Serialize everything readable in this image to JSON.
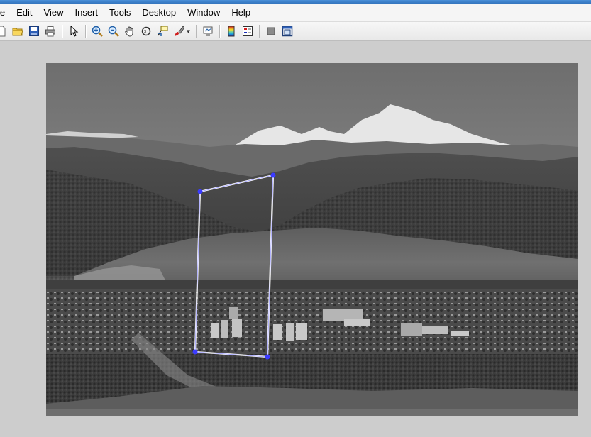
{
  "menubar": {
    "items": [
      "le",
      "Edit",
      "View",
      "Insert",
      "Tools",
      "Desktop",
      "Window",
      "Help"
    ]
  },
  "toolbar": {
    "buttons": [
      "new-figure-icon",
      "open-file-icon",
      "save-icon",
      "print-icon",
      "edit-plot-arrow-icon",
      "zoom-in-icon",
      "zoom-out-icon",
      "pan-hand-icon",
      "rotate-3d-icon",
      "data-cursor-icon",
      "brush-icon",
      "link-plot-icon",
      "colorbar-icon",
      "legend-icon",
      "hide-plot-tools-icon",
      "show-plot-tools-icon"
    ]
  },
  "colors": {
    "roi_line": "#ffffff",
    "roi_handle": "#3b3bff",
    "figure_background": "#cdcdcd"
  },
  "image": {
    "description_icon": "grayscale-landscape-image"
  }
}
